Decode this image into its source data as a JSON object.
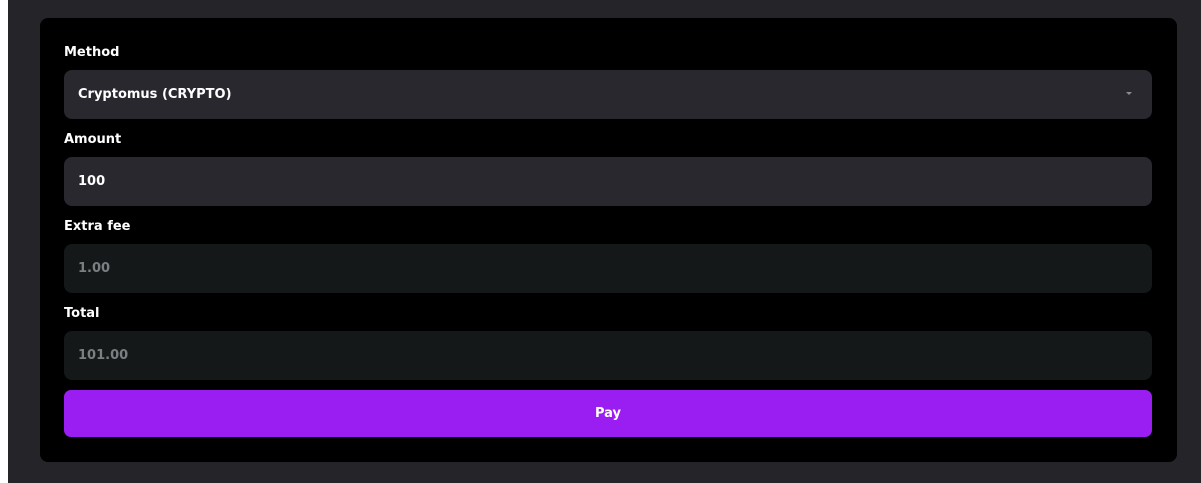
{
  "colors": {
    "page_background": "#252429",
    "card_background": "#000000",
    "input_background": "#29282e",
    "readonly_background": "#141819",
    "readonly_text": "#7b7f82",
    "accent": "#9a1ef2"
  },
  "form": {
    "method": {
      "label": "Method",
      "selected": "Cryptomus (CRYPTO)",
      "icon": "chevron-down-icon"
    },
    "amount": {
      "label": "Amount",
      "value": "100"
    },
    "extra_fee": {
      "label": "Extra fee",
      "value": "1.00"
    },
    "total": {
      "label": "Total",
      "value": "101.00"
    },
    "pay_button": {
      "label": "Pay"
    }
  }
}
